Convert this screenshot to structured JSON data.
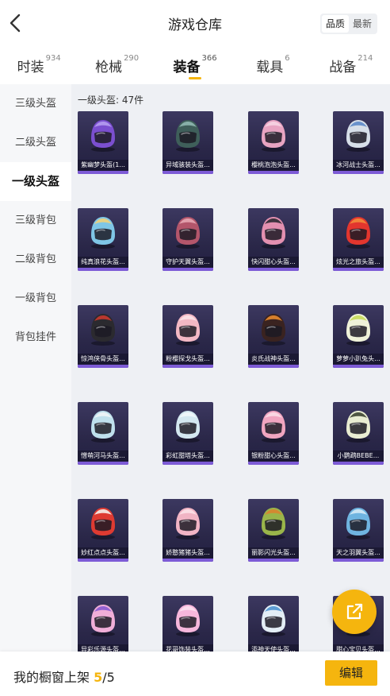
{
  "header": {
    "title": "游戏仓库",
    "sort_options": [
      "品质",
      "最新"
    ],
    "sort_active": 0
  },
  "tabs": [
    {
      "label": "时装",
      "count": "934"
    },
    {
      "label": "枪械",
      "count": "290"
    },
    {
      "label": "装备",
      "count": "366"
    },
    {
      "label": "载具",
      "count": "6"
    },
    {
      "label": "战备",
      "count": "214"
    }
  ],
  "active_tab": 2,
  "sidebar": {
    "items": [
      "三级头盔",
      "二级头盔",
      "一级头盔",
      "三级背包",
      "二级背包",
      "一级背包",
      "背包挂件"
    ],
    "active": 2
  },
  "content": {
    "count_label": "一级头盔: 47件",
    "items": [
      {
        "name": "紫幽梦头盔(1...",
        "color": "#7b4fd0",
        "accent": "#b59cf0"
      },
      {
        "name": "异域骇装头盔...",
        "color": "#3f5f5a",
        "accent": "#8fb8b0"
      },
      {
        "name": "樱桃泡泡头盔...",
        "color": "#e8a4c2",
        "accent": "#f6d4e3"
      },
      {
        "name": "冰河战士头盔...",
        "color": "#d7dfe8",
        "accent": "#5d89c8"
      },
      {
        "name": "纯真浪花头盔...",
        "color": "#7fc6e6",
        "accent": "#f2d27a"
      },
      {
        "name": "守护天翼头盔...",
        "color": "#b3566b",
        "accent": "#e5a7b3"
      },
      {
        "name": "快闪甜心头盔...",
        "color": "#e390b0",
        "accent": "#2d2a33"
      },
      {
        "name": "炫光之旅头盔...",
        "color": "#e2362e",
        "accent": "#f28b3a"
      },
      {
        "name": "惊鸿侠骨头盔...",
        "color": "#2b2a2f",
        "accent": "#c9392f"
      },
      {
        "name": "粉樱探戈头盔...",
        "color": "#f3b8c4",
        "accent": "#fbe3e8"
      },
      {
        "name": "炎氏战神头盔...",
        "color": "#3a2320",
        "accent": "#e8892e"
      },
      {
        "name": "萝萝小趴兔头...",
        "color": "#eff2d9",
        "accent": "#c7da5a"
      },
      {
        "name": "憎萌河马头盔...",
        "color": "#bfe0ec",
        "accent": "#eef4f7"
      },
      {
        "name": "彩虹甜塔头盔...",
        "color": "#d4e8f0",
        "accent": "#f2f7f9"
      },
      {
        "name": "银粉甜心头盔...",
        "color": "#f0a5c0",
        "accent": "#f9dbe6"
      },
      {
        "name": "小鹦鹉BEBE...",
        "color": "#e9edd2",
        "accent": "#3e4532"
      },
      {
        "name": "妙红点点头盔...",
        "color": "#de3b32",
        "accent": "#f5f1ea"
      },
      {
        "name": "娇憨猪猪头盔...",
        "color": "#f1b4c4",
        "accent": "#fce1e8"
      },
      {
        "name": "丽影闪光头盔...",
        "color": "#9ab54a",
        "accent": "#d9842f"
      },
      {
        "name": "天之羽翼头盔...",
        "color": "#6fb4e0",
        "accent": "#d5eaf6"
      },
      {
        "name": "异彩乐源头盔...",
        "color": "#f0aed8",
        "accent": "#8a5ad0"
      },
      {
        "name": "花哥饰装头盔...",
        "color": "#f7b7dc",
        "accent": "#fbe1f0"
      },
      {
        "name": "添神天使头盔...",
        "color": "#e3eef5",
        "accent": "#4f93d0"
      },
      {
        "name": "甜心宝贝头盔...",
        "color": "#f6c3d4",
        "accent": "#fde6ee"
      }
    ]
  },
  "footer": {
    "label": "我的橱窗上架",
    "current": "5",
    "total": "/5",
    "edit_label": "编辑"
  },
  "colors": {
    "accent": "#f5b50e",
    "card_bar": "#7d5bd6"
  },
  "icons": {
    "back": "chevron-left-icon",
    "share": "external-link-icon"
  }
}
